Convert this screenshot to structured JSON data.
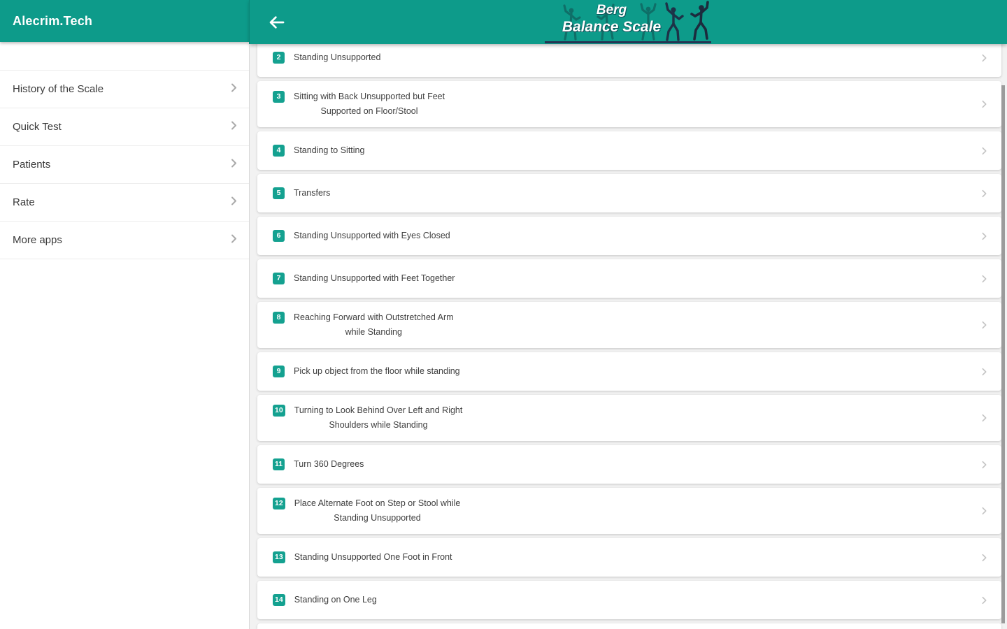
{
  "colors": {
    "teal": "#0d9b8a",
    "teal_dark": "#0a8577",
    "badge": "#14a190",
    "underline": "#253452"
  },
  "sidebar": {
    "app_title": "Alecrim.Tech",
    "chevron_icon": "chevron-right-icon",
    "items": [
      {
        "label": "History of the Scale"
      },
      {
        "label": "Quick Test"
      },
      {
        "label": "Patients"
      },
      {
        "label": "Rate"
      },
      {
        "label": "More apps"
      }
    ]
  },
  "header": {
    "back_icon": "arrow-left-icon",
    "logo_icon": "dancing-figures-icon",
    "logo_line1": "Berg",
    "logo_line2": "Balance Scale"
  },
  "main": {
    "items": [
      {
        "number": "2",
        "label": "Standing Unsupported"
      },
      {
        "number": "3",
        "label": "Sitting with Back Unsupported but Feet\nSupported on Floor/Stool"
      },
      {
        "number": "4",
        "label": "Standing to Sitting"
      },
      {
        "number": "5",
        "label": "Transfers"
      },
      {
        "number": "6",
        "label": "Standing Unsupported with Eyes Closed"
      },
      {
        "number": "7",
        "label": "Standing Unsupported with Feet Together"
      },
      {
        "number": "8",
        "label": "Reaching Forward with Outstretched Arm\nwhile Standing"
      },
      {
        "number": "9",
        "label": "Pick up object from the floor while standing"
      },
      {
        "number": "10",
        "label": "Turning to Look Behind Over Left and Right\nShoulders while Standing"
      },
      {
        "number": "11",
        "label": "Turn 360 Degrees"
      },
      {
        "number": "12",
        "label": "Place Alternate Foot on Step or Stool while\nStanding Unsupported"
      },
      {
        "number": "13",
        "label": "Standing Unsupported One Foot in Front"
      },
      {
        "number": "14",
        "label": "Standing on One Leg"
      }
    ]
  }
}
